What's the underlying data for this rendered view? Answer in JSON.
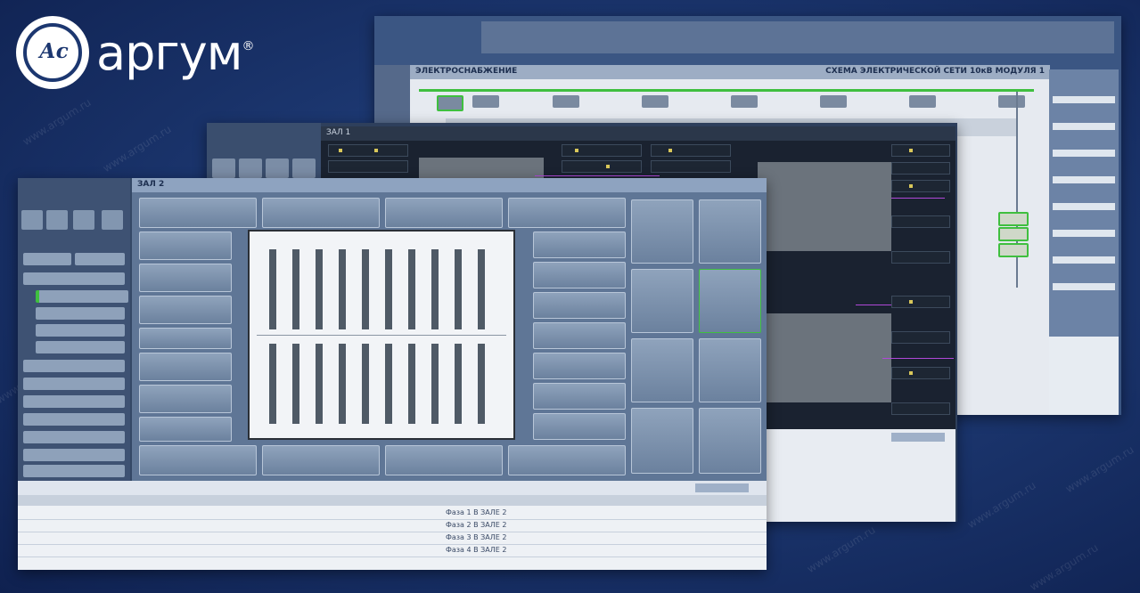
{
  "brand": {
    "logo_monogram": "Ас",
    "name": "аргум",
    "registered": "®"
  },
  "watermark_text": "www.argum.ru",
  "colors": {
    "background": "#1c3770",
    "panel": "#6b819e",
    "accent_green": "#3fbf3f",
    "accent_magenta": "#b048d8",
    "indicator_yellow": "#d9c75a"
  },
  "back_window": {
    "title_left": "ЭЛЕКТРОСНАБЖЕНИЕ",
    "title_right": "СХЕМА ЭЛЕКТРИЧЕСКОЙ СЕТИ 10кВ МОДУЛЯ 1"
  },
  "middle_window": {
    "title": "ЗАЛ 1"
  },
  "front_window": {
    "title": "ЗАЛ 2",
    "table_rows": [
      "Фаза 1 В ЗАЛЕ 2",
      "Фаза 2 В ЗАЛЕ 2",
      "Фаза 3 В ЗАЛЕ 2",
      "Фаза 4 В ЗАЛЕ 2"
    ]
  }
}
